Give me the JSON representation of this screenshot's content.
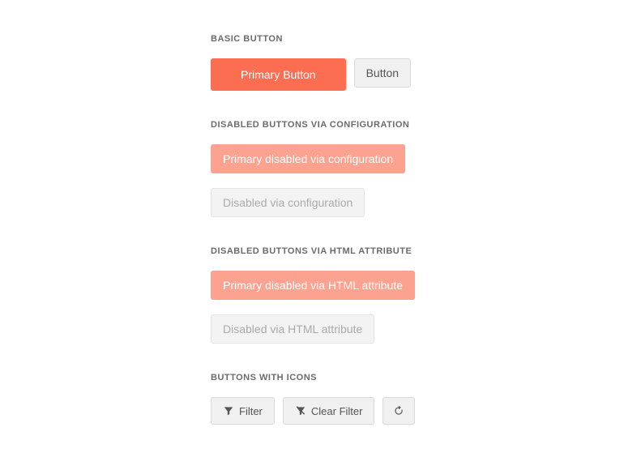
{
  "sections": {
    "basic": {
      "heading": "BASIC BUTTON",
      "primary_label": "Primary Button",
      "default_label": "Button"
    },
    "disabled_config": {
      "heading": "DISABLED BUTTONS VIA CONFIGURATION",
      "primary_label": "Primary disabled via configuration",
      "default_label": "Disabled via configuration"
    },
    "disabled_html": {
      "heading": "DISABLED BUTTONS VIA HTML ATTRIBUTE",
      "primary_label": "Primary disabled via HTML attribute",
      "default_label": "Disabled via HTML attribute"
    },
    "with_icons": {
      "heading": "BUTTONS WITH ICONS",
      "filter_label": "Filter",
      "clear_filter_label": "Clear Filter"
    }
  }
}
